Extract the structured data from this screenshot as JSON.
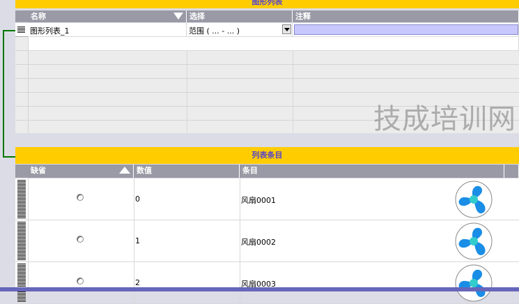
{
  "graphic_list": {
    "title": "图形列表",
    "columns": {
      "name": "名称",
      "select": "选择",
      "comment": "注释"
    },
    "row1": {
      "name": "图形列表_1",
      "select": "范围 ( ... - ... )",
      "comment": ""
    }
  },
  "list_items": {
    "title": "列表条目",
    "columns": {
      "default": "缺省",
      "value": "数值",
      "item": "条目"
    },
    "rows": [
      {
        "value": "0",
        "item": "风扇0001",
        "icon": "fan-icon"
      },
      {
        "value": "1",
        "item": "风扇0002",
        "icon": "fan-icon"
      },
      {
        "value": "2",
        "item": "风扇0003",
        "icon": "fan-icon"
      }
    ]
  },
  "watermark": "技成培训网",
  "colors": {
    "title_bar": "#ffcc00",
    "title_text": "#5544cc",
    "header": "#9a9aa6",
    "selected_cell": "#c8c8ff",
    "connector": "#007700"
  }
}
